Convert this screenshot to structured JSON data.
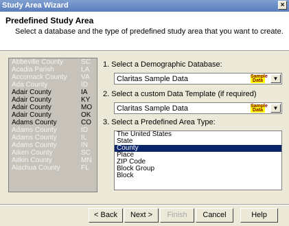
{
  "window": {
    "title": "Study Area Wizard",
    "close_glyph": "×"
  },
  "header": {
    "title": "Predefined Study Area",
    "subtitle": "Select a database and the type of predefined study area that you want to create."
  },
  "counties": [
    {
      "name": "Abbeville County",
      "state": "SC",
      "dim": true
    },
    {
      "name": "Acadia Parish",
      "state": "LA",
      "dim": true
    },
    {
      "name": "Accomack County",
      "state": "VA",
      "dim": true
    },
    {
      "name": "Ada County",
      "state": "ID",
      "dim": true
    },
    {
      "name": "Adair County",
      "state": "IA",
      "dim": false
    },
    {
      "name": "Adair County",
      "state": "KY",
      "dim": false
    },
    {
      "name": "Adair County",
      "state": "MO",
      "dim": false
    },
    {
      "name": "Adair County",
      "state": "OK",
      "dim": false
    },
    {
      "name": "Adams County",
      "state": "CO",
      "dim": false
    },
    {
      "name": "Adams County",
      "state": "ID",
      "dim": true
    },
    {
      "name": "Adams County",
      "state": "IL",
      "dim": true
    },
    {
      "name": "Adams County",
      "state": "IN",
      "dim": true
    },
    {
      "name": "Aiken County",
      "state": "SC",
      "dim": true
    },
    {
      "name": "Aitkin County",
      "state": "MN",
      "dim": true
    },
    {
      "name": "Alachua County",
      "state": "FL",
      "dim": true
    }
  ],
  "step1": {
    "label": "1.  Select a Demographic Database:",
    "value": "Claritas Sample Data",
    "badge": "Sample Data"
  },
  "step2": {
    "label": "2.  Select a custom Data Template (if required)",
    "value": "Claritas Sample Data",
    "badge": "Sample Data"
  },
  "step3": {
    "label": "3.  Select a Predefined Area Type:",
    "options": [
      "The United States",
      "State",
      "County",
      "Place",
      "ZIP Code",
      "Block Group",
      "Block"
    ],
    "selected": "County"
  },
  "buttons": {
    "back": "< Back",
    "next": "Next >",
    "finish": "Finish",
    "cancel": "Cancel",
    "help": "Help"
  }
}
